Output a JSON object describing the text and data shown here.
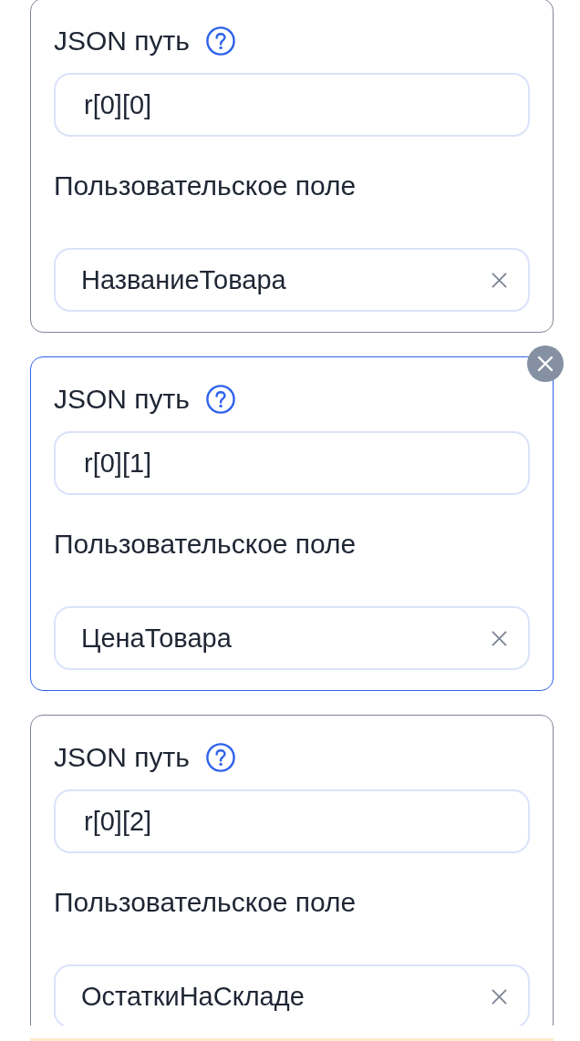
{
  "mappings": [
    {
      "selected": false,
      "path_label": "JSON путь",
      "path_value": "r[0][0]",
      "field_label": "Пользовательское поле",
      "field_value": "НазваниеТовара"
    },
    {
      "selected": true,
      "path_label": "JSON путь",
      "path_value": "r[0][1]",
      "field_label": "Пользовательское поле",
      "field_value": "ЦенаТовара"
    },
    {
      "selected": false,
      "path_label": "JSON путь",
      "path_value": "r[0][2]",
      "field_label": "Пользовательское поле",
      "field_value": "ОстаткиНаСкладе"
    }
  ]
}
